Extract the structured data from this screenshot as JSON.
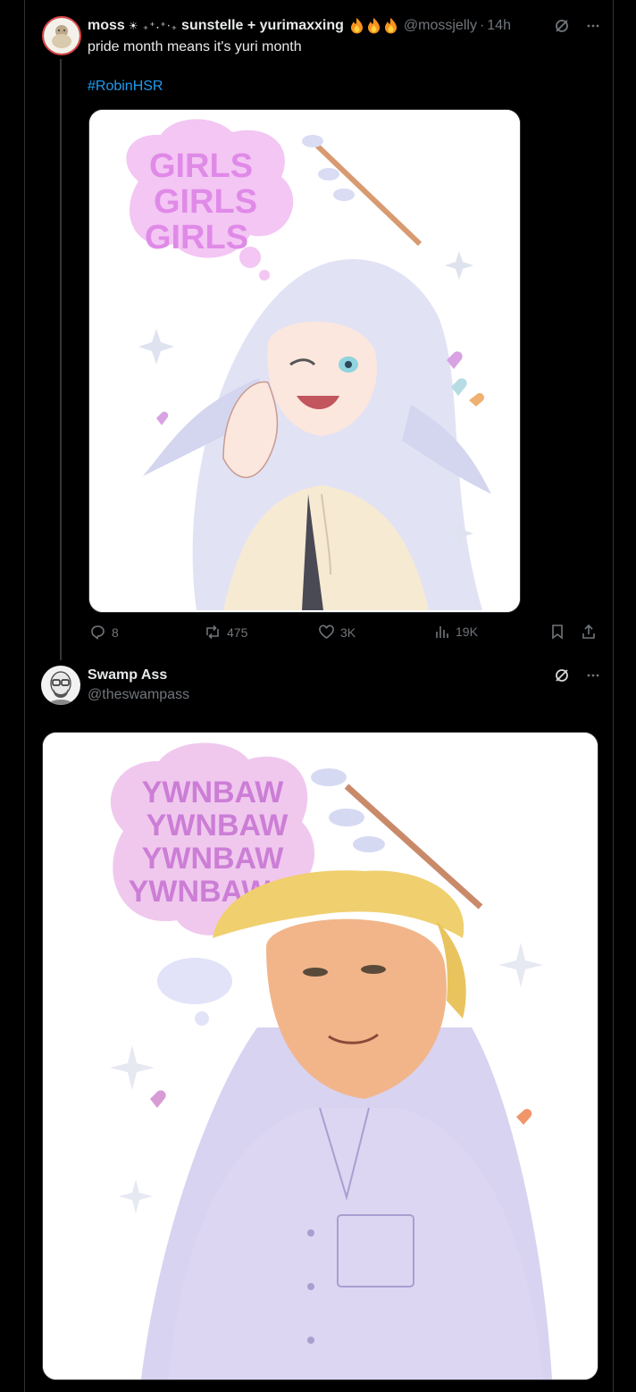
{
  "post1": {
    "display_name_start": "moss",
    "display_name_deco": "☀ ₊⁺˖⁺‧₊",
    "display_name_end": "sunstelle + yurimaxxing",
    "fire_icons": [
      "fire-icon",
      "fire-icon",
      "fire-icon"
    ],
    "handle": "@mossjelly",
    "separator": "·",
    "timestamp": "14h",
    "text": "pride month means it's yuri month",
    "hashtag": "#RobinHSR",
    "image_text_lines": [
      "GIRLS",
      "GIRLS",
      "GIRLS"
    ],
    "replies": "8",
    "reposts": "475",
    "likes": "3K",
    "views": "19K"
  },
  "post2": {
    "display_name": "Swamp Ass",
    "handle": "@theswampass",
    "image_text_lines": [
      "YWNBAW",
      "YWNBAW",
      "YWNBAW",
      "YWNBAW"
    ]
  },
  "colors": {
    "background": "#000000",
    "text": "#e7e9ea",
    "muted": "#71767b",
    "link": "#1d9bf0",
    "border": "#2f3336"
  },
  "icons": [
    "grok-icon",
    "more-icon",
    "reply-icon",
    "repost-icon",
    "like-icon",
    "views-icon",
    "bookmark-icon",
    "share-icon"
  ]
}
